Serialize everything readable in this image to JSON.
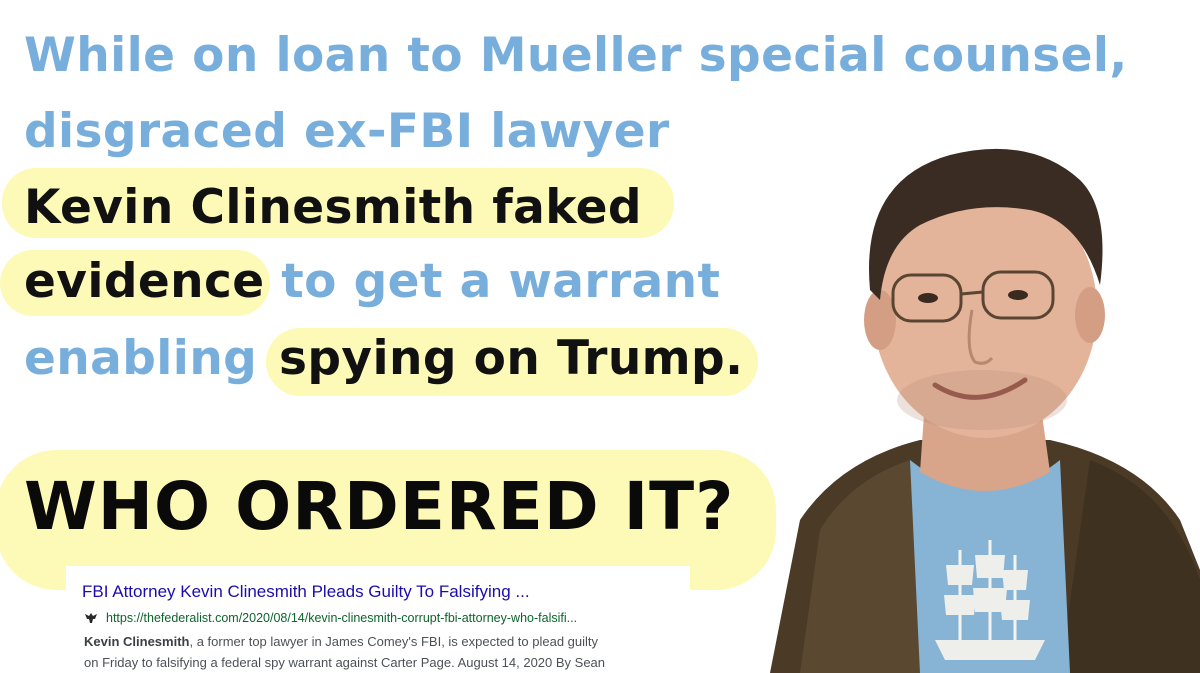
{
  "headline": {
    "line1": "While on loan to Mueller special counsel,",
    "line2": "disgraced ex-FBI lawyer",
    "line3": "Kevin Clinesmith faked",
    "line4_dark": "evidence",
    "line4_blue": " to get a warrant",
    "line5_blue": "enabling",
    "line5_dark": "spying on Trump."
  },
  "question": "WHO ORDERED IT?",
  "search_result": {
    "title": "FBI Attorney Kevin Clinesmith Pleads Guilty To Falsifying ...",
    "url": "https://thefederalist.com/2020/08/14/kevin-clinesmith-corrupt-fbi-attorney-who-falsifi...",
    "snippet_bold": "Kevin Clinesmith",
    "snippet_line1_rest": ", a former top lawyer in James Comey's FBI, is expected to plead guilty",
    "snippet_line2": "on Friday to falsifying a federal spy warrant against Carter Page. August 14, 2020 By Sean",
    "favicon": "eagle-icon"
  },
  "colors": {
    "blue_text": "#78aedc",
    "highlight": "#fdfab8",
    "dark_text": "#111111",
    "link": "#1a0dab",
    "url": "#0d652d"
  }
}
